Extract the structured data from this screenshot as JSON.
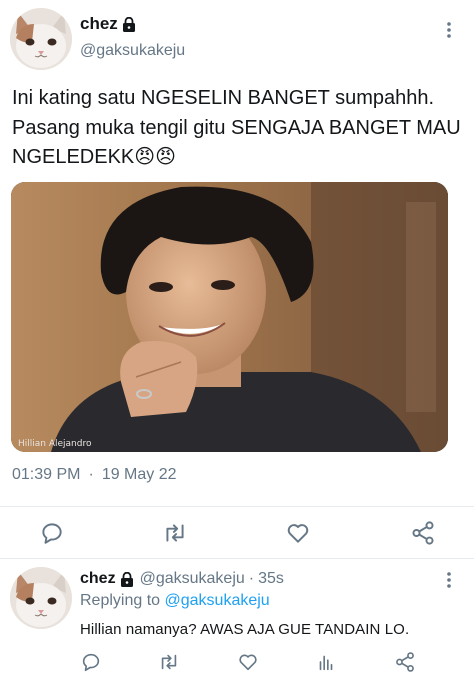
{
  "main_tweet": {
    "display_name": "chez",
    "handle": "@gaksukakeju",
    "text": "Ini kating satu NGESELIN BANGET sumpahhh. Pasang muka tengil gitu SENGAJA BANGET MAU NGELEDEKK😠😠",
    "media_caption": "Hillian Alejandro",
    "time": "01:39 PM",
    "separator": "·",
    "date": "19 May 22"
  },
  "reply": {
    "display_name": "chez",
    "handle": "@gaksukakeju",
    "separator": "·",
    "age": "35s",
    "replying_to_label": "Replying to",
    "replying_to_handle": "@gaksukakeju",
    "text": "Hillian namanya? AWAS AJA GUE TANDAIN LO."
  },
  "icons": {
    "lock": "lock-icon",
    "more": "more-vertical-icon",
    "reply": "reply-icon",
    "retweet": "retweet-icon",
    "like": "heart-icon",
    "analytics": "analytics-icon",
    "share": "share-icon"
  },
  "colors": {
    "text_primary": "#14171a",
    "text_secondary": "#657786",
    "link": "#1da1f2",
    "divider": "#e6ecf0"
  }
}
